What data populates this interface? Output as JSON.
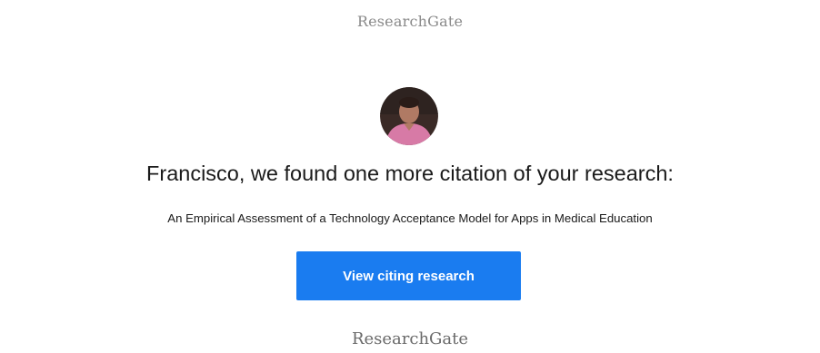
{
  "header": {
    "brand": "ResearchGate"
  },
  "profile": {
    "avatar_label": "user-avatar"
  },
  "message": {
    "headline": "Francisco, we found one more citation of your research:",
    "citation_title": "An Empirical Assessment of a Technology Acceptance Model for Apps in Medical Education"
  },
  "cta": {
    "label": "View citing research",
    "color": "#1a7cf0"
  },
  "footer": {
    "brand": "ResearchGate"
  }
}
